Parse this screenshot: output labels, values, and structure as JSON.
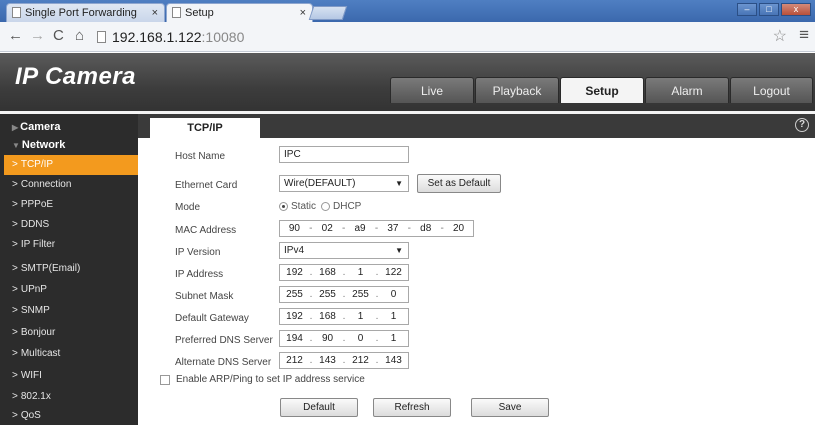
{
  "browser": {
    "tabs": [
      {
        "label": "Single Port Forwarding"
      },
      {
        "label": "Setup"
      }
    ],
    "url_host": "192.168.1.122",
    "url_port": ":10080"
  },
  "header": {
    "logo": "IP Camera",
    "nav": [
      "Live",
      "Playback",
      "Setup",
      "Alarm",
      "Logout"
    ],
    "active_nav": "Setup"
  },
  "sidebar": {
    "categories": [
      "Camera",
      "Network"
    ],
    "items": [
      "TCP/IP",
      "Connection",
      "PPPoE",
      "DDNS",
      "IP Filter",
      "SMTP(Email)",
      "UPnP",
      "SNMP",
      "Bonjour",
      "Multicast",
      "WIFI",
      "802.1x",
      "QoS"
    ],
    "active_item": "TCP/IP"
  },
  "content": {
    "tab": "TCP/IP",
    "help": "?",
    "host_name": {
      "label": "Host Name",
      "value": "IPC"
    },
    "ethernet_card": {
      "label": "Ethernet Card",
      "value": "Wire(DEFAULT)",
      "button": "Set as Default"
    },
    "mode": {
      "label": "Mode",
      "options": [
        "Static",
        "DHCP"
      ],
      "selected": "Static"
    },
    "mac": {
      "label": "MAC Address",
      "octets": [
        "90",
        "02",
        "a9",
        "37",
        "d8",
        "20"
      ]
    },
    "ip_version": {
      "label": "IP Version",
      "value": "IPv4"
    },
    "ip_address": {
      "label": "IP Address",
      "octets": [
        "192",
        "168",
        "1",
        "122"
      ]
    },
    "subnet": {
      "label": "Subnet Mask",
      "octets": [
        "255",
        "255",
        "255",
        "0"
      ]
    },
    "gateway": {
      "label": "Default Gateway",
      "octets": [
        "192",
        "168",
        "1",
        "1"
      ]
    },
    "dns1": {
      "label": "Preferred DNS Server",
      "octets": [
        "194",
        "90",
        "0",
        "1"
      ]
    },
    "dns2": {
      "label": "Alternate DNS Server",
      "octets": [
        "212",
        "143",
        "212",
        "143"
      ]
    },
    "arp": {
      "label": "Enable ARP/Ping to set IP address service",
      "checked": false
    },
    "buttons": {
      "default": "Default",
      "refresh": "Refresh",
      "save": "Save"
    }
  }
}
